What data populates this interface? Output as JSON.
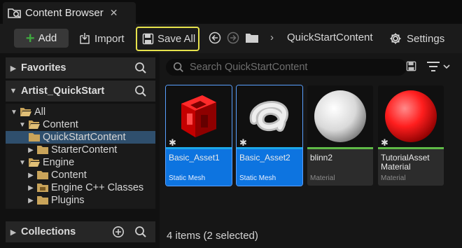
{
  "tab": {
    "title": "Content Browser",
    "close": "✕"
  },
  "toolbar": {
    "add_label": "Add",
    "import_label": "Import",
    "save_all_label": "Save All",
    "breadcrumb_sep": "›",
    "breadcrumb": "QuickStartContent",
    "settings_label": "Settings"
  },
  "sidebar": {
    "favorites": "Favorites",
    "project": "Artist_QuickStart",
    "collections": "Collections",
    "tree": [
      {
        "label": "All"
      },
      {
        "label": "Content"
      },
      {
        "label": "QuickStartContent",
        "selected": true
      },
      {
        "label": "StarterContent"
      },
      {
        "label": "Engine"
      },
      {
        "label": "Content"
      },
      {
        "label": "Engine C++ Classes"
      },
      {
        "label": "Plugins"
      }
    ]
  },
  "search": {
    "placeholder": "Search QuickStartContent"
  },
  "assets": [
    {
      "name": "Basic_Asset1",
      "type": "Static Mesh",
      "selected": true,
      "bar_color": "#1da7e8"
    },
    {
      "name": "Basic_Asset2",
      "type": "Static Mesh",
      "selected": true,
      "bar_color": "#1da7e8"
    },
    {
      "name": "blinn2",
      "type": "Material",
      "selected": false,
      "bar_color": "#5fba47"
    },
    {
      "name": "TutorialAsset Material",
      "type": "Material",
      "selected": false,
      "bar_color": "#5fba47"
    }
  ],
  "status": "4 items (2 selected)",
  "colors": {
    "accent": "#0d74e0",
    "highlight": "#e6e24c",
    "add_green": "#3fa83f"
  }
}
